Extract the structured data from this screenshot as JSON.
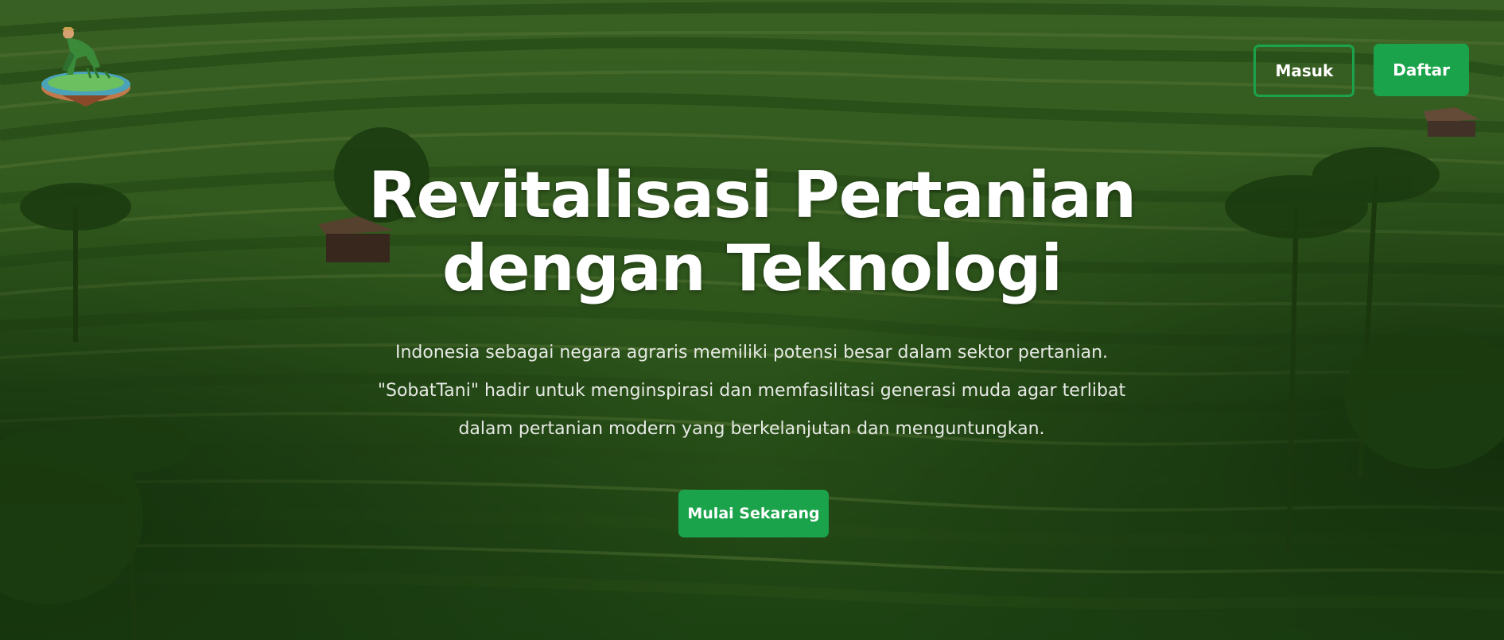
{
  "header": {
    "logo_icon": "farmer-planting-logo",
    "login_label": "Masuk",
    "register_label": "Daftar"
  },
  "hero": {
    "title_line1": "Revitalisasi Pertanian",
    "title_line2": "dengan Teknologi",
    "subtitle_line1": "Indonesia sebagai negara agraris memiliki potensi besar dalam sektor pertanian.",
    "subtitle_line2": "\"SobatTani\" hadir untuk menginspirasi dan memfasilitasi generasi muda agar terlibat",
    "subtitle_line3": "dalam pertanian modern yang berkelanjutan dan menguntungkan.",
    "cta_label": "Mulai Sekarang"
  },
  "colors": {
    "accent": "#1aa34a",
    "text": "#ffffff"
  }
}
